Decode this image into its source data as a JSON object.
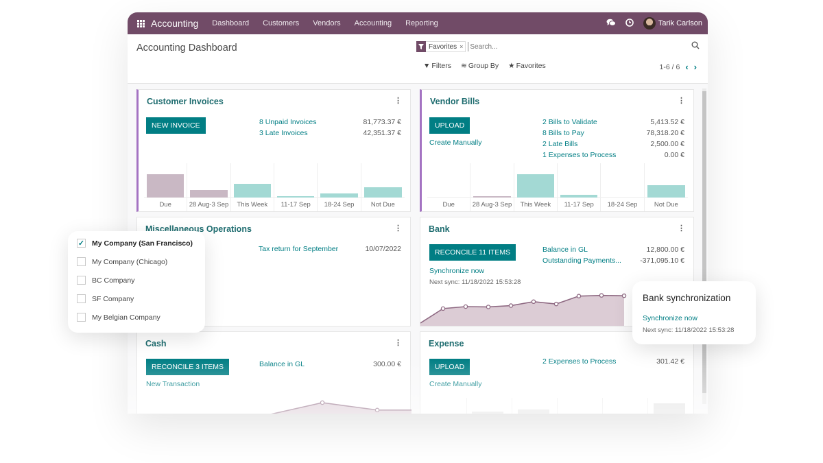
{
  "navbar": {
    "app_name": "Accounting",
    "menu": [
      "Dashboard",
      "Customers",
      "Vendors",
      "Accounting",
      "Reporting"
    ],
    "user_name": "Tarik Carlson",
    "icons": [
      "apps-grid-icon",
      "chat-icon",
      "clock-icon"
    ]
  },
  "control_panel": {
    "title": "Accounting Dashboard",
    "facet_label": "Favorites",
    "facet_icon": "filter-icon",
    "search_placeholder": "Search...",
    "filters_label": "Filters",
    "groupby_label": "Group By",
    "favorites_label": "Favorites",
    "pager": "1-6 / 6"
  },
  "colors": {
    "navbar": "#714b67",
    "primary": "#017e84",
    "accent_border": "#a473c2",
    "bar_past": "#c9b8c4",
    "bar_future": "#a3d9d4",
    "line": "#8f6a83",
    "line_fill": "#dcccd5"
  },
  "cards": {
    "customer_invoices": {
      "title": "Customer Invoices",
      "button": "NEW INVOICE",
      "rows": [
        {
          "label": "8 Unpaid Invoices",
          "amount": "81,773.37 €"
        },
        {
          "label": "3 Late Invoices",
          "amount": "42,351.37 €"
        }
      ],
      "chart": {
        "categories": [
          "Due",
          "28 Aug-3 Sep",
          "This Week",
          "11-17 Sep",
          "18-24 Sep",
          "Not Due"
        ],
        "values": [
          100,
          33,
          60,
          7,
          17,
          44
        ],
        "kinds": [
          "past",
          "past",
          "future",
          "future",
          "future",
          "future"
        ]
      }
    },
    "vendor_bills": {
      "title": "Vendor Bills",
      "button": "UPLOAD",
      "secondary_link": "Create Manually",
      "rows": [
        {
          "label": "2 Bills to Validate",
          "amount": "5,413.52 €"
        },
        {
          "label": "8 Bills to Pay",
          "amount": "78,318.20 €"
        },
        {
          "label": "2 Late Bills",
          "amount": "2,500.00 €"
        },
        {
          "label": "1 Expenses to Process",
          "amount": "0.00 €"
        }
      ],
      "chart": {
        "categories": [
          "Due",
          "28 Aug-3 Sep",
          "This Week",
          "11-17 Sep",
          "18-24 Sep",
          "Not Due"
        ],
        "values": [
          0,
          6,
          100,
          11,
          0,
          52
        ],
        "kinds": [
          "past",
          "past",
          "future",
          "future",
          "future",
          "future"
        ]
      }
    },
    "misc_operations": {
      "title": "Miscellaneous Operations",
      "rows": [
        {
          "label": "Tax return for September",
          "amount": "10/07/2022"
        }
      ]
    },
    "bank": {
      "title": "Bank",
      "button": "RECONCILE 11 ITEMS",
      "secondary_link": "Synchronize now",
      "next_sync": "Next sync: 11/18/2022 15:53:28",
      "rows": [
        {
          "label": "Balance in GL",
          "amount": "12,800.00 €"
        },
        {
          "label": "Outstanding Payments...",
          "amount": "-371,095.10 €"
        }
      ],
      "chart": {
        "type": "line",
        "values": [
          0,
          44,
          50,
          49,
          53,
          65,
          58,
          82,
          84,
          83
        ]
      }
    },
    "cash": {
      "title": "Cash",
      "button": "RECONCILE 3 ITEMS",
      "secondary_link": "New Transaction",
      "rows": [
        {
          "label": "Balance in GL",
          "amount": "300.00 €"
        }
      ],
      "chart": {
        "type": "line",
        "values": [
          0,
          100,
          40,
          40
        ]
      }
    },
    "expense": {
      "title": "Expense",
      "button": "UPLOAD",
      "secondary_link": "Create Manually",
      "rows": [
        {
          "label": "2 Expenses to Process",
          "amount": "301.42 €"
        }
      ]
    }
  },
  "company_switcher": {
    "items": [
      {
        "name": "My Company (San Francisco)",
        "checked": true
      },
      {
        "name": "My Company (Chicago)",
        "checked": false
      },
      {
        "name": "BC Company",
        "checked": false
      },
      {
        "name": "SF Company",
        "checked": false
      },
      {
        "name": "My Belgian Company",
        "checked": false
      }
    ]
  },
  "bank_sync_popup": {
    "title": "Bank synchronization",
    "link": "Synchronize now",
    "next_sync": "Next sync: 11/18/2022 15:53:28"
  }
}
